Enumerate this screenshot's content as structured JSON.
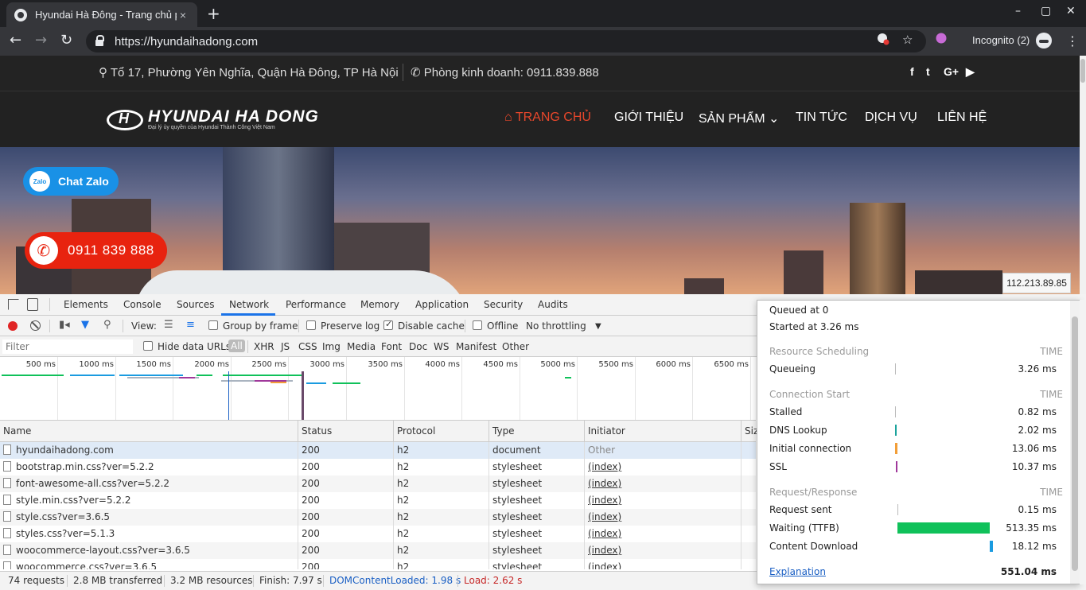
{
  "browser": {
    "tab_title": "Hyundai Hà Đông - Trang chủ p",
    "url": "https://hyundaihadong.com",
    "profile": "Incognito (2)",
    "icons": {
      "back": "←",
      "forward": "→",
      "reload": "↻",
      "close_tab": "×",
      "new_tab": "+",
      "star": "☆",
      "menu": "⋮",
      "minimize": "–",
      "maximize": "▢",
      "close_window": "✕"
    }
  },
  "site": {
    "address": "Tổ 17, Phường Yên Nghĩa, Quận Hà Đông, TP Hà Nội",
    "phone": "Phòng kinh doanh: 0911.839.888",
    "social": [
      "f",
      "t",
      "G+",
      "▶"
    ],
    "logo_text": "HYUNDAI HA DONG",
    "logo_sub": "Đại lý ủy quyền của Hyundai Thành Công Việt Nam",
    "nav": [
      "TRANG CHỦ",
      "GIỚI THIỆU",
      "SẢN PHẨM",
      "TIN TỨC",
      "DỊCH VỤ",
      "LIÊN HỆ"
    ],
    "zalo_label": "Chat Zalo",
    "zalo_icon_text": "Zalo",
    "hotline": "0911 839 888",
    "ip_tooltip": "112.213.89.85"
  },
  "devtools": {
    "tabs": [
      "Elements",
      "Console",
      "Sources",
      "Network",
      "Performance",
      "Memory",
      "Application",
      "Security",
      "Audits"
    ],
    "active_tab": "Network",
    "view_label": "View:",
    "group_by_frame": "Group by frame",
    "preserve_log": "Preserve log",
    "disable_cache": "Disable cache",
    "offline": "Offline",
    "throttling": "No throttling",
    "filter_placeholder": "Filter",
    "hide_data_urls": "Hide data URLs",
    "type_filters": [
      "All",
      "XHR",
      "JS",
      "CSS",
      "Img",
      "Media",
      "Font",
      "Doc",
      "WS",
      "Manifest",
      "Other"
    ],
    "timeline_ticks": [
      "500 ms",
      "1000 ms",
      "1500 ms",
      "2000 ms",
      "2500 ms",
      "3000 ms",
      "3500 ms",
      "4000 ms",
      "4500 ms",
      "5000 ms",
      "5500 ms",
      "6000 ms",
      "6500 ms"
    ],
    "columns": [
      "Name",
      "Status",
      "Protocol",
      "Type",
      "Initiator",
      "Siz"
    ],
    "rows": [
      {
        "name": "hyundaihadong.com",
        "status": "200",
        "protocol": "h2",
        "type": "document",
        "initiator": "Other"
      },
      {
        "name": "bootstrap.min.css?ver=5.2.2",
        "status": "200",
        "protocol": "h2",
        "type": "stylesheet",
        "initiator": "(index)"
      },
      {
        "name": "font-awesome-all.css?ver=5.2.2",
        "status": "200",
        "protocol": "h2",
        "type": "stylesheet",
        "initiator": "(index)"
      },
      {
        "name": "style.min.css?ver=5.2.2",
        "status": "200",
        "protocol": "h2",
        "type": "stylesheet",
        "initiator": "(index)"
      },
      {
        "name": "style.css?ver=3.6.5",
        "status": "200",
        "protocol": "h2",
        "type": "stylesheet",
        "initiator": "(index)"
      },
      {
        "name": "styles.css?ver=5.1.3",
        "status": "200",
        "protocol": "h2",
        "type": "stylesheet",
        "initiator": "(index)"
      },
      {
        "name": "woocommerce-layout.css?ver=3.6.5",
        "status": "200",
        "protocol": "h2",
        "type": "stylesheet",
        "initiator": "(index)"
      },
      {
        "name": "woocommerce.css?ver=3.6.5",
        "status": "200",
        "protocol": "h2",
        "type": "stylesheet",
        "initiator": "(index)"
      }
    ],
    "statusbar": {
      "requests": "74 requests",
      "transferred": "2.8 MB transferred",
      "resources": "3.2 MB resources",
      "finish": "Finish: 7.97 s",
      "dom_loaded": "DOMContentLoaded: 1.98 s",
      "load": "Load: 2.62 s"
    }
  },
  "timing": {
    "queued_at": "Queued at 0",
    "started_at": "Started at 3.26 ms",
    "time_header": "TIME",
    "sections": [
      {
        "title": "Resource Scheduling",
        "items": [
          {
            "label": "Queueing",
            "value": "3.26 ms"
          }
        ]
      },
      {
        "title": "Connection Start",
        "items": [
          {
            "label": "Stalled",
            "value": "0.82 ms"
          },
          {
            "label": "DNS Lookup",
            "value": "2.02 ms"
          },
          {
            "label": "Initial connection",
            "value": "13.06 ms"
          },
          {
            "label": "SSL",
            "value": "10.37 ms"
          }
        ]
      },
      {
        "title": "Request/Response",
        "items": [
          {
            "label": "Request sent",
            "value": "0.15 ms"
          },
          {
            "label": "Waiting (TTFB)",
            "value": "513.35 ms"
          },
          {
            "label": "Content Download",
            "value": "18.12 ms"
          }
        ]
      }
    ],
    "explanation": "Explanation",
    "total": "551.04 ms",
    "colors": {
      "dns": "#1ba39c",
      "connect": "#f29e38",
      "ssl": "#a0389b",
      "ttfb": "#10c15a",
      "download": "#1a9be0"
    }
  }
}
